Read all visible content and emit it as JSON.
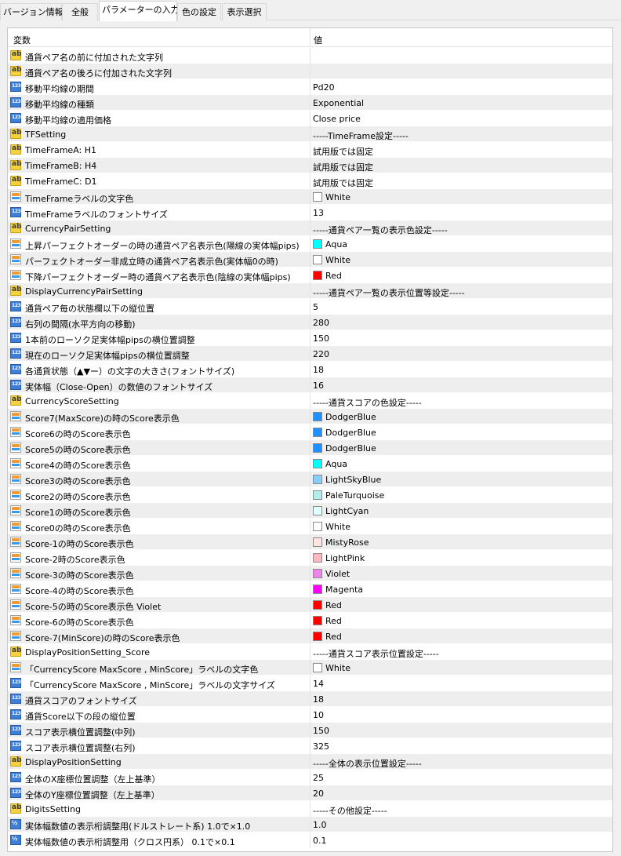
{
  "tabs": [
    {
      "label": "バージョン情報",
      "active": false
    },
    {
      "label": "全般",
      "active": false
    },
    {
      "label": "パラメーターの入力",
      "active": true
    },
    {
      "label": "色の設定",
      "active": false
    },
    {
      "label": "表示選択",
      "active": false
    }
  ],
  "table": {
    "header_name": "変数",
    "header_value": "値",
    "rows": [
      {
        "icon": "ab-icon",
        "name": "通貨ペア名の前に付加された文字列",
        "value": ""
      },
      {
        "icon": "ab-icon",
        "name": "通貨ペア名の後ろに付加された文字列",
        "value": ""
      },
      {
        "icon": "number-icon",
        "name": "移動平均線の期間",
        "value": "Pd20"
      },
      {
        "icon": "number-icon",
        "name": "移動平均線の種類",
        "value": "Exponential"
      },
      {
        "icon": "number-icon",
        "name": "移動平均線の適用価格",
        "value": "Close price"
      },
      {
        "icon": "ab-icon",
        "name": "TFSetting",
        "value": "-----TimeFrame設定-----"
      },
      {
        "icon": "ab-icon",
        "name": "TimeFrameA: H1",
        "value": "試用版では固定"
      },
      {
        "icon": "ab-icon",
        "name": "TimeFrameB: H4",
        "value": "試用版では固定"
      },
      {
        "icon": "ab-icon",
        "name": "TimeFrameC: D1",
        "value": "試用版では固定"
      },
      {
        "icon": "color-icon",
        "name": "TimeFrameラベルの文字色",
        "value": "White",
        "swatch": "#ffffff"
      },
      {
        "icon": "number-icon",
        "name": "TimeFrameラベルのフォントサイズ",
        "value": "13"
      },
      {
        "icon": "ab-icon",
        "name": "CurrencyPairSetting",
        "value": "-----通貨ペア一覧の表示色設定-----"
      },
      {
        "icon": "color-icon",
        "name": "上昇パーフェクトオーダーの時の通貨ペア名表示色(陽線の実体幅pips)",
        "value": "Aqua",
        "swatch": "#00ffff"
      },
      {
        "icon": "color-icon",
        "name": "パーフェクトオーダー非成立時の通貨ペア名表示色(実体幅0の時)",
        "value": "White",
        "swatch": "#ffffff"
      },
      {
        "icon": "color-icon",
        "name": "下降パーフェクトオーダー時の通貨ペア名表示色(陰線の実体幅pips)",
        "value": "Red",
        "swatch": "#ff0000"
      },
      {
        "icon": "ab-icon",
        "name": "DisplayCurrencyPairSetting",
        "value": "-----通貨ペア一覧の表示位置等設定-----"
      },
      {
        "icon": "number-icon",
        "name": "通貨ペア毎の状態欄以下の縦位置",
        "value": "5"
      },
      {
        "icon": "number-icon",
        "name": "右列の間隔(水平方向の移動)",
        "value": "280"
      },
      {
        "icon": "number-icon",
        "name": "1本前のローソク足実体幅pipsの横位置調整",
        "value": "150"
      },
      {
        "icon": "number-icon",
        "name": "現在のローソク足実体幅pipsの横位置調整",
        "value": "220"
      },
      {
        "icon": "number-icon",
        "name": "各通貨状態（▲▼ー）の文字の大きさ(フォントサイズ)",
        "value": "18"
      },
      {
        "icon": "number-icon",
        "name": "実体幅（Close-Open）の数値のフォントサイズ",
        "value": "16"
      },
      {
        "icon": "ab-icon",
        "name": "CurrencyScoreSetting",
        "value": "-----通貨スコアの色設定-----"
      },
      {
        "icon": "color-icon",
        "name": "Score7(MaxScore)の時のScore表示色",
        "value": "DodgerBlue",
        "swatch": "#1e90ff"
      },
      {
        "icon": "color-icon",
        "name": "Score6の時のScore表示色",
        "value": "DodgerBlue",
        "swatch": "#1e90ff"
      },
      {
        "icon": "color-icon",
        "name": "Score5の時のScore表示色",
        "value": "DodgerBlue",
        "swatch": "#1e90ff"
      },
      {
        "icon": "color-icon",
        "name": "Score4の時のScore表示色",
        "value": "Aqua",
        "swatch": "#00ffff"
      },
      {
        "icon": "color-icon",
        "name": "Score3の時のScore表示色",
        "value": "LightSkyBlue",
        "swatch": "#87cefa"
      },
      {
        "icon": "color-icon",
        "name": "Score2の時のScore表示色",
        "value": "PaleTurquoise",
        "swatch": "#afeeee"
      },
      {
        "icon": "color-icon",
        "name": "Score1の時のScore表示色",
        "value": "LightCyan",
        "swatch": "#e0ffff"
      },
      {
        "icon": "color-icon",
        "name": "Score0の時のScore表示色",
        "value": "White",
        "swatch": "#ffffff"
      },
      {
        "icon": "color-icon",
        "name": "Score-1の時のScore表示色",
        "value": "MistyRose",
        "swatch": "#ffe4e1"
      },
      {
        "icon": "color-icon",
        "name": "Score-2時のScore表示色",
        "value": "LightPink",
        "swatch": "#ffb6c1"
      },
      {
        "icon": "color-icon",
        "name": "Score-3の時のScore表示色",
        "value": "Violet",
        "swatch": "#ee82ee"
      },
      {
        "icon": "color-icon",
        "name": "Score-4の時のScore表示色",
        "value": "Magenta",
        "swatch": "#ff00ff"
      },
      {
        "icon": "color-icon",
        "name": "Score-5の時のScore表示色 Violet",
        "value": "Red",
        "swatch": "#ff0000"
      },
      {
        "icon": "color-icon",
        "name": "Score-6の時のScore表示色",
        "value": "Red",
        "swatch": "#ff0000"
      },
      {
        "icon": "color-icon",
        "name": "Score-7(MinScore)の時のScore表示色",
        "value": "Red",
        "swatch": "#ff0000"
      },
      {
        "icon": "ab-icon",
        "name": "DisplayPositionSetting_Score",
        "value": "-----通貨スコア表示位置設定-----"
      },
      {
        "icon": "color-icon",
        "name": "「CurrencyScore MaxScore , MinScore」ラベルの文字色",
        "value": "White",
        "swatch": "#ffffff"
      },
      {
        "icon": "number-icon",
        "name": "「CurrencyScore MaxScore , MinScore」ラベルの文字サイズ",
        "value": "14"
      },
      {
        "icon": "number-icon",
        "name": "通貨スコアのフォントサイズ",
        "value": "18"
      },
      {
        "icon": "number-icon",
        "name": "通貨Score以下の段の縦位置",
        "value": "10"
      },
      {
        "icon": "number-icon",
        "name": "スコア表示横位置調整(中列)",
        "value": "150"
      },
      {
        "icon": "number-icon",
        "name": "スコア表示横位置調整(右列)",
        "value": "325"
      },
      {
        "icon": "ab-icon",
        "name": "DisplayPositionSetting",
        "value": "-----全体の表示位置設定-----"
      },
      {
        "icon": "number-icon",
        "name": "全体のX座標位置調整（左上基準）",
        "value": "25"
      },
      {
        "icon": "number-icon",
        "name": "全体のY座標位置調整（左上基準）",
        "value": "20"
      },
      {
        "icon": "ab-icon",
        "name": "DigitsSetting",
        "value": "-----その他設定-----"
      },
      {
        "icon": "double-icon",
        "name": "実体幅数値の表示桁調整用(ドルストレート系) 1.0で×1.0",
        "value": "1.0"
      },
      {
        "icon": "double-icon",
        "name": "実体幅数値の表示桁調整用（クロス円系） 0.1で×0.1",
        "value": "0.1"
      }
    ]
  }
}
